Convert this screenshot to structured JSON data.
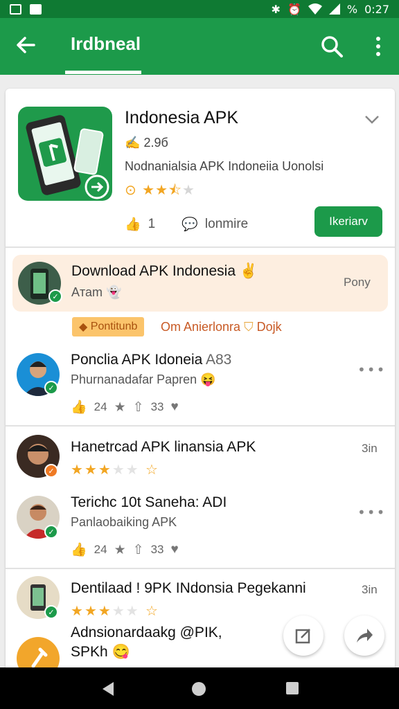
{
  "status_bar": {
    "left_icons": [
      "notification-icon",
      "image-icon"
    ],
    "right_icons": [
      "bluetooth-icon",
      "alarm-icon",
      "wifi-icon",
      "signal-icon",
      "battery-icon"
    ],
    "battery": "%",
    "time": "0:27"
  },
  "app_bar": {
    "title": "Irdbneal",
    "color": "#1c9a4a"
  },
  "app": {
    "name": "Indonesia APK",
    "downloads": "2.9б",
    "description": "Nodnanialsia APK Indoneiia Uonolsi",
    "rating_stars": 2.5,
    "likes": "1",
    "comments_label": "lonmire",
    "install_label": "Ikeriarv"
  },
  "items": [
    {
      "title": "Download APK Indonesia",
      "subtitle": "Aтаm",
      "time": "Pony",
      "highlighted": true,
      "emoji": "✌"
    },
    {
      "title": "Ponclia APK Idoneia",
      "title_suffix": "A83",
      "subtitle": "Phurnanadafar Papren",
      "emoji": "😝",
      "stats": {
        "likes": "24",
        "shares": "33"
      }
    },
    {
      "title": "Hanetrcad APK linansia APK",
      "time": "3in",
      "rating_stars": 3
    },
    {
      "title": "Terichc 10t Saneha: ADI",
      "subtitle": "Panlaobaiking APK",
      "stats": {
        "likes": "24",
        "shares": "33"
      }
    },
    {
      "title": "Dentilaad ! 9PK INdonsia Pegekanni",
      "time": "3in",
      "rating_stars": 3
    },
    {
      "title": "Adnsionardaakg @PIK,",
      "title2": "SPKh",
      "emoji": "😋"
    }
  ],
  "tag": {
    "label": "Pontitunb",
    "text": "Om Anierlonra",
    "text2": "Dojk"
  },
  "nav": [
    "back-icon",
    "home-icon",
    "recents-icon"
  ]
}
